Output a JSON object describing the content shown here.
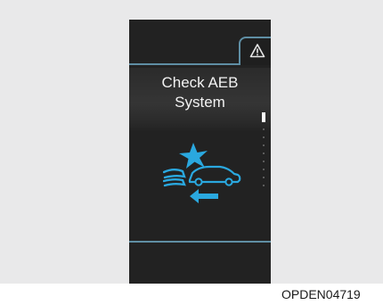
{
  "display": {
    "tab": {
      "icon": "warning-triangle-icon"
    },
    "message": {
      "line1": "Check AEB",
      "line2": "System"
    },
    "illustration": {
      "icon": "aeb-collision-icon",
      "color": "#2aa8df"
    }
  },
  "figure_code": "OPDEN04719",
  "colors": {
    "frame": "#e9e9ea",
    "screen": "#222222",
    "accent_line": "#5f8ea4",
    "icon": "#2aa8df"
  }
}
